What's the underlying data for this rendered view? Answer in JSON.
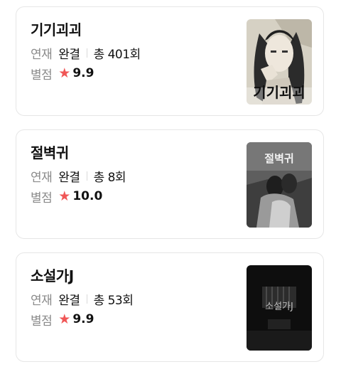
{
  "labels": {
    "status": "연재",
    "rating": "별점"
  },
  "items": [
    {
      "title": "기기괴괴",
      "status": "완결",
      "episodes": "총 401회",
      "rating": "9.9",
      "cover_text": "기기괴괴"
    },
    {
      "title": "절벽귀",
      "status": "완결",
      "episodes": "총 8회",
      "rating": "10.0",
      "cover_text": "절벽귀"
    },
    {
      "title": "소설가J",
      "status": "완결",
      "episodes": "총 53회",
      "rating": "9.9",
      "cover_text": "소설가J"
    }
  ],
  "colors": {
    "star": "#f05656",
    "label": "#8a8a8a",
    "border": "#e6e6e6"
  },
  "icons": {
    "rating": "star-icon"
  }
}
